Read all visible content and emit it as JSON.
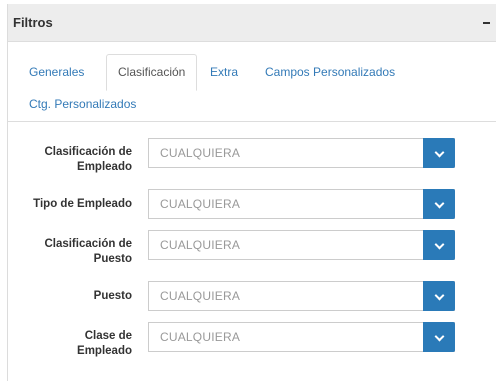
{
  "panel": {
    "title": "Filtros"
  },
  "tabs": [
    {
      "label": "Generales",
      "active": false
    },
    {
      "label": "Clasificación",
      "active": true
    },
    {
      "label": "Extra",
      "active": false
    },
    {
      "label": "Campos Personalizados",
      "active": false
    },
    {
      "label": "Ctg. Personalizados",
      "active": false
    }
  ],
  "filters": [
    {
      "label_line1": "Clasificación de",
      "label_line2": "Empleado",
      "value": "CUALQUIERA"
    },
    {
      "label_line1": "Tipo de Empleado",
      "label_line2": "",
      "value": "CUALQUIERA"
    },
    {
      "label_line1": "Clasificación de",
      "label_line2": "Puesto",
      "value": "CUALQUIERA"
    },
    {
      "label_line1": "Puesto",
      "label_line2": "",
      "value": "CUALQUIERA"
    },
    {
      "label_line1": "Clase de",
      "label_line2": "Empleado",
      "value": "CUALQUIERA"
    }
  ],
  "icons": {
    "collapse": "minus-icon",
    "dropdown": "chevron-down-icon"
  },
  "colors": {
    "accent": "#2a7ab8",
    "link": "#337ab7",
    "header_bg": "#ededed"
  }
}
